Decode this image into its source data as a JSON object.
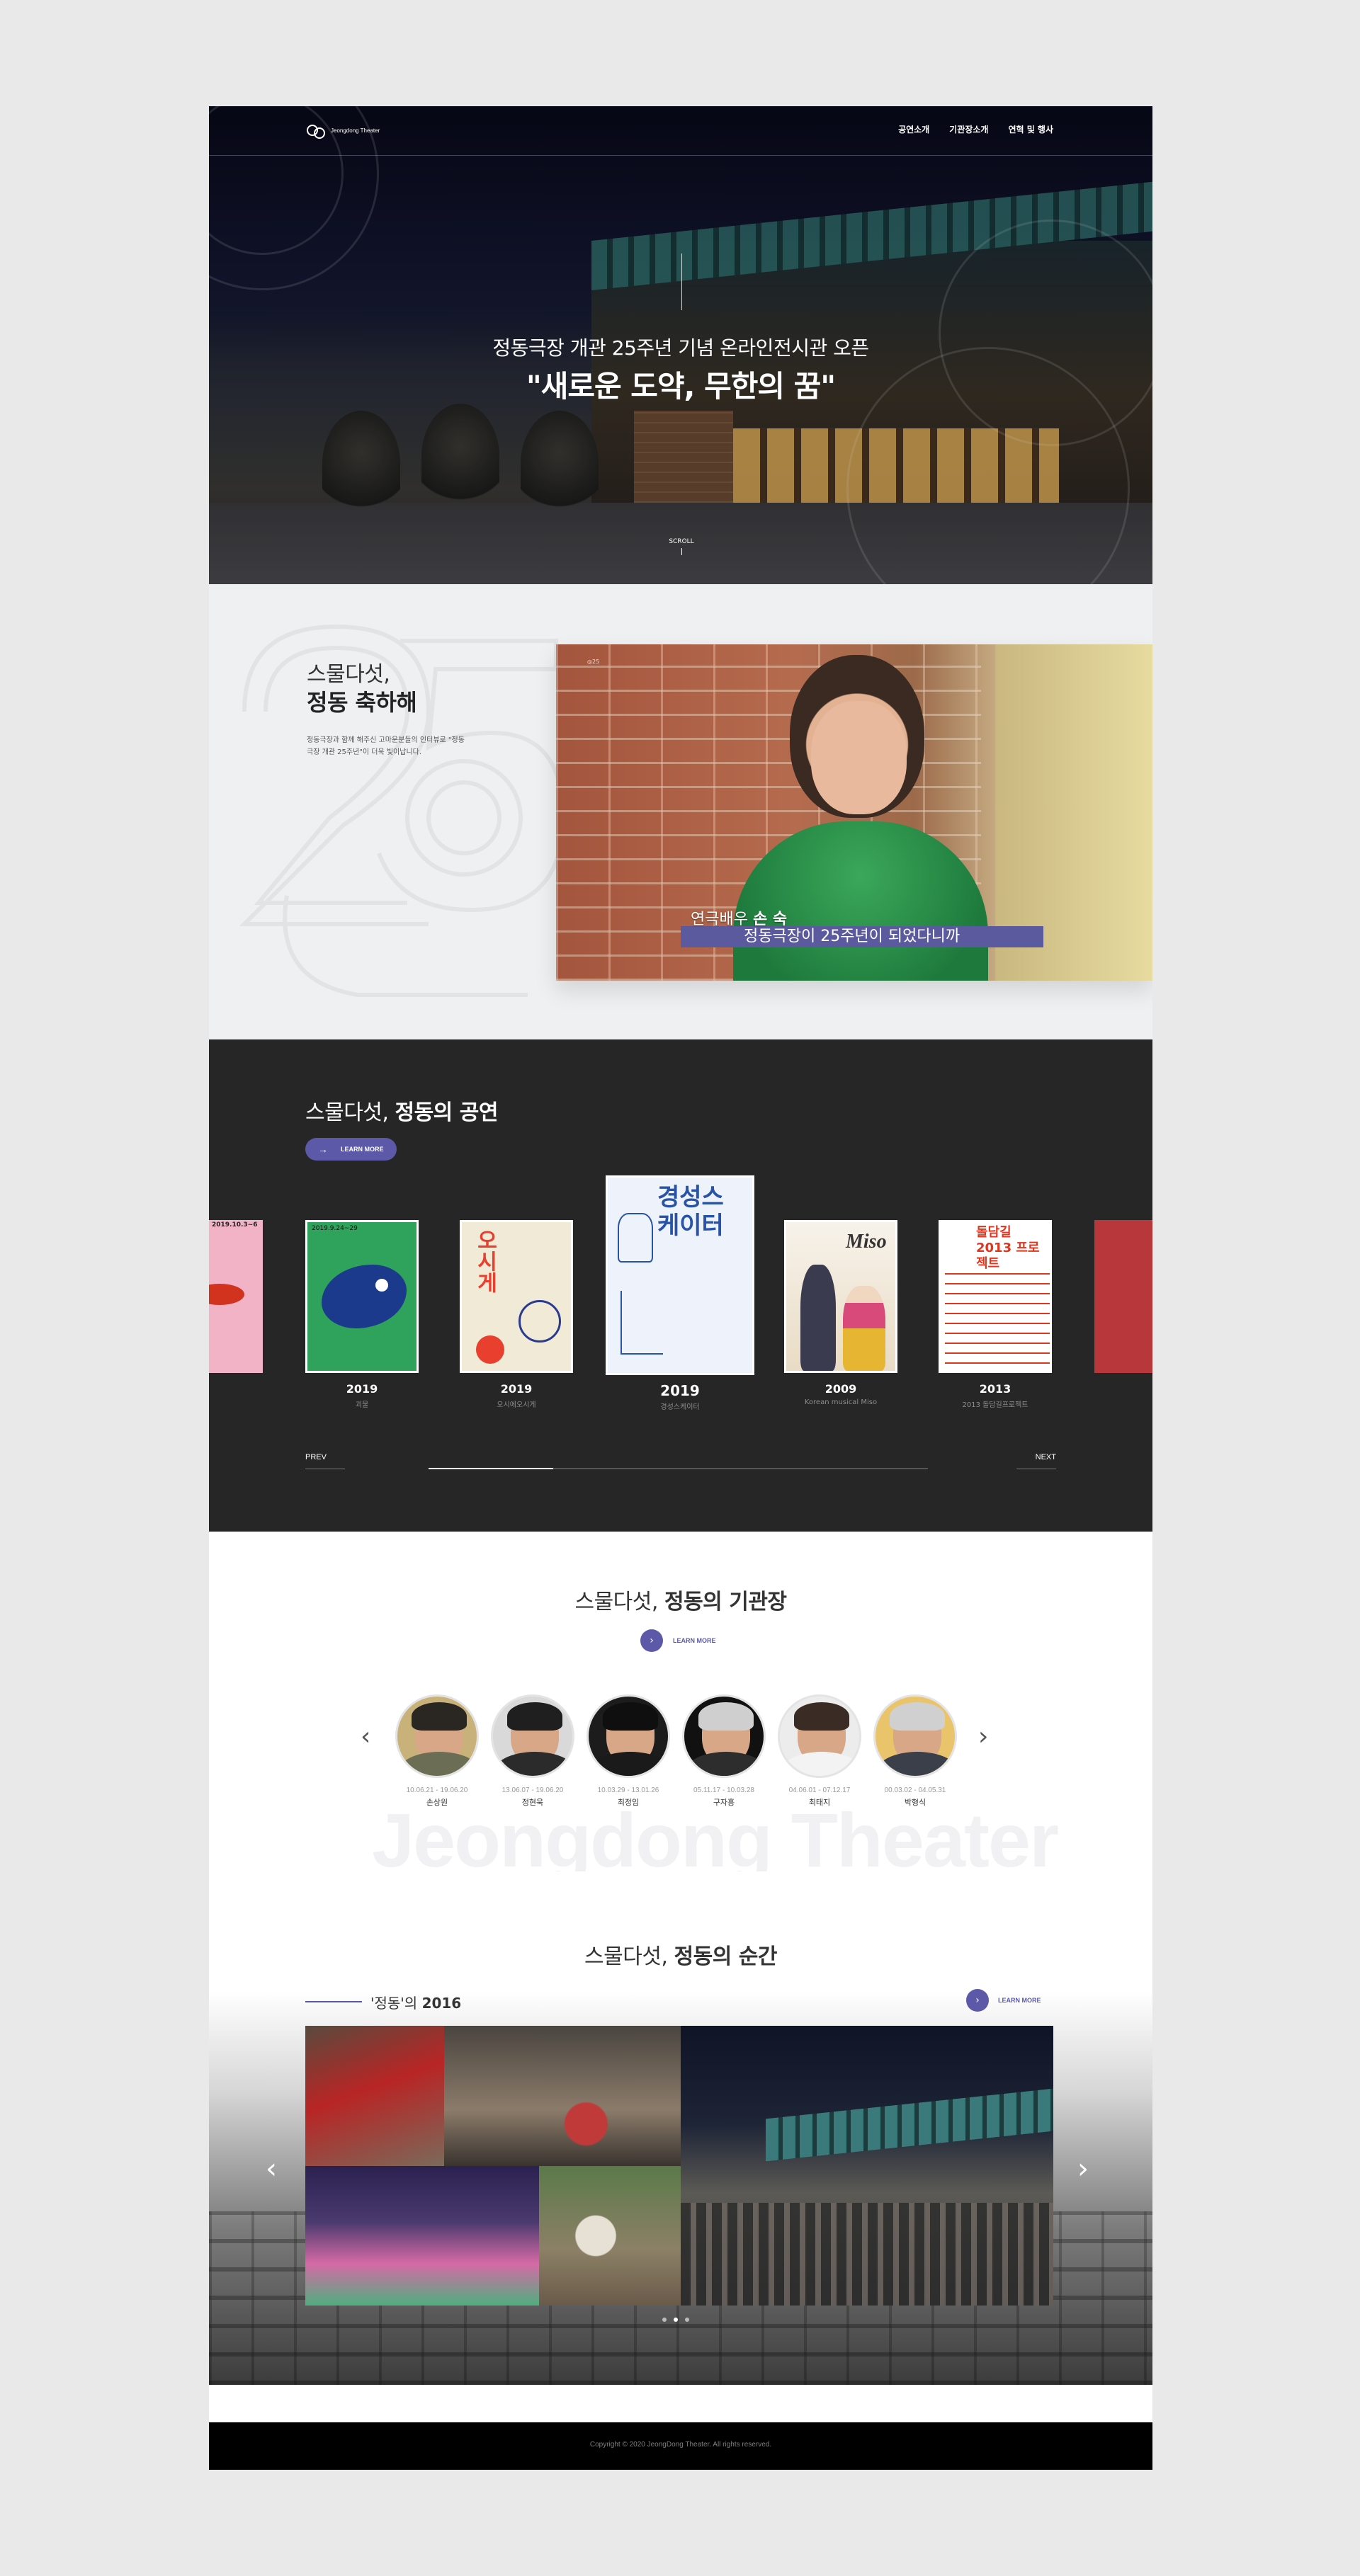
{
  "header": {
    "logo_text": "Jeongdong Theater",
    "nav": [
      "공연소개",
      "기관장소개",
      "연혁 및 행사"
    ]
  },
  "hero": {
    "subtitle": "정동극장 개관 25주년 기념 온라인전시관 오픈",
    "title": "\"새로운 도약, 무한의 꿈\"",
    "scroll_label": "SCROLL"
  },
  "celebrate": {
    "title_light": "스물다섯,",
    "title_bold": "정동 축하해",
    "description": "정동극장과 함께 해주신 고마운분들의 인터뷰로 \"정동극장 개관 25주년\"이 더욱 빛이납니다.",
    "video": {
      "role": "연극배우",
      "name": "손 숙",
      "caption": "정동극장이 25주년이 되었다니까"
    }
  },
  "performances": {
    "title_light": "스물다섯, ",
    "title_bold": "정동의 공연",
    "learn_more": "LEARN MORE",
    "items": [
      {
        "year": "2019",
        "caption": "괴물"
      },
      {
        "year": "2019",
        "caption": "오시에오시게"
      },
      {
        "year": "2019",
        "caption": "경성스케이터"
      },
      {
        "year": "2009",
        "caption": "Korean musical Miso"
      },
      {
        "year": "2013",
        "caption": "2013 돌담길프로젝트"
      }
    ],
    "poster_texts": {
      "p0": "2019.10.3~6",
      "p1": "2019.9.24~29",
      "p2": "오시게",
      "p3": "경성스케이터",
      "p4": "Miso",
      "p5": "돌담길 2013 프로젝트"
    },
    "prev": "PREV",
    "next": "NEXT",
    "progress": 0.25
  },
  "directors": {
    "title_light": "스물다섯, ",
    "title_bold": "정동의 기관장",
    "learn_more": "LEARN MORE",
    "watermark": "Jeongdong Theater",
    "items": [
      {
        "term": "10.06.21 - 19.06.20",
        "name": "손상원"
      },
      {
        "term": "13.06.07 - 19.06.20",
        "name": "정현욱"
      },
      {
        "term": "10.03.29 - 13.01.26",
        "name": "최정임"
      },
      {
        "term": "05.11.17 - 10.03.28",
        "name": "구자흥"
      },
      {
        "term": "04.06.01 - 07.12.17",
        "name": "최태지"
      },
      {
        "term": "00.03.02 - 04.05.31",
        "name": "박형식"
      }
    ]
  },
  "moments": {
    "title_light": "스물다섯, ",
    "title_bold": "정동의 순간",
    "year_prefix": "'정동'의 ",
    "year": "2016",
    "learn_more": "LEARN MORE",
    "active_slide": 1,
    "slide_count": 3
  },
  "footer": {
    "copyright": "Copyright © 2020 JeongDong Theater. All rights reserved."
  },
  "colors": {
    "accent": "#5b59a8",
    "dark_section": "#262626",
    "light_section": "#eff0f2"
  }
}
